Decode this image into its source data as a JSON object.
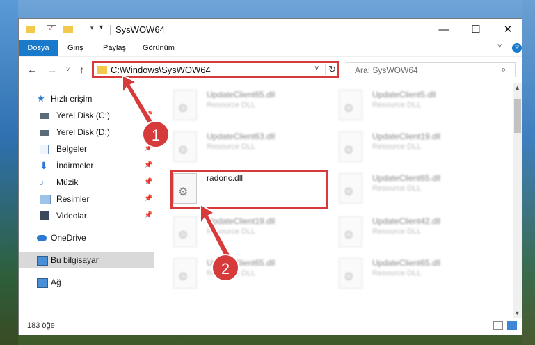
{
  "window": {
    "title": "SysWOW64"
  },
  "ribbon": {
    "tabs": [
      "Dosya",
      "Giriş",
      "Paylaş",
      "Görünüm"
    ],
    "help": "?"
  },
  "address": {
    "path": "C:\\Windows\\SysWOW64"
  },
  "search": {
    "placeholder": "Ara: SysWOW64"
  },
  "sidebar": {
    "items": [
      {
        "label": "Hızlı erişim"
      },
      {
        "label": "Yerel Disk (C:)"
      },
      {
        "label": "Yerel Disk (D:)"
      },
      {
        "label": "Belgeler"
      },
      {
        "label": "İndirmeler"
      },
      {
        "label": "Müzik"
      },
      {
        "label": "Resimler"
      },
      {
        "label": "Videolar"
      },
      {
        "label": "OneDrive"
      },
      {
        "label": "Bu bilgisayar"
      },
      {
        "label": "Ağ"
      }
    ]
  },
  "files": [
    {
      "name": "UpdateClient65.dll",
      "type": "Resource DLL"
    },
    {
      "name": "UpdateClient5.dll",
      "type": "Resource DLL"
    },
    {
      "name": "UpdateClient63.dll",
      "type": "Resource DLL"
    },
    {
      "name": "UpdateClient19.dll",
      "type": "Resource DLL"
    },
    {
      "name": "radonc.dll",
      "type": ""
    },
    {
      "name": "UpdateClient65.dll",
      "type": "Resource DLL"
    },
    {
      "name": "UpdateClient19.dll",
      "type": "Resource DLL"
    },
    {
      "name": "UpdateClient42.dll",
      "type": "Resource DLL"
    },
    {
      "name": "UpdateClient65.dll",
      "type": "Resource DLL"
    },
    {
      "name": "UpdateClient65.dll",
      "type": "Resource DLL"
    }
  ],
  "status": {
    "count": "183 öğe"
  },
  "annotations": {
    "step1": "1",
    "step2": "2",
    "color": "#d63a3a"
  }
}
